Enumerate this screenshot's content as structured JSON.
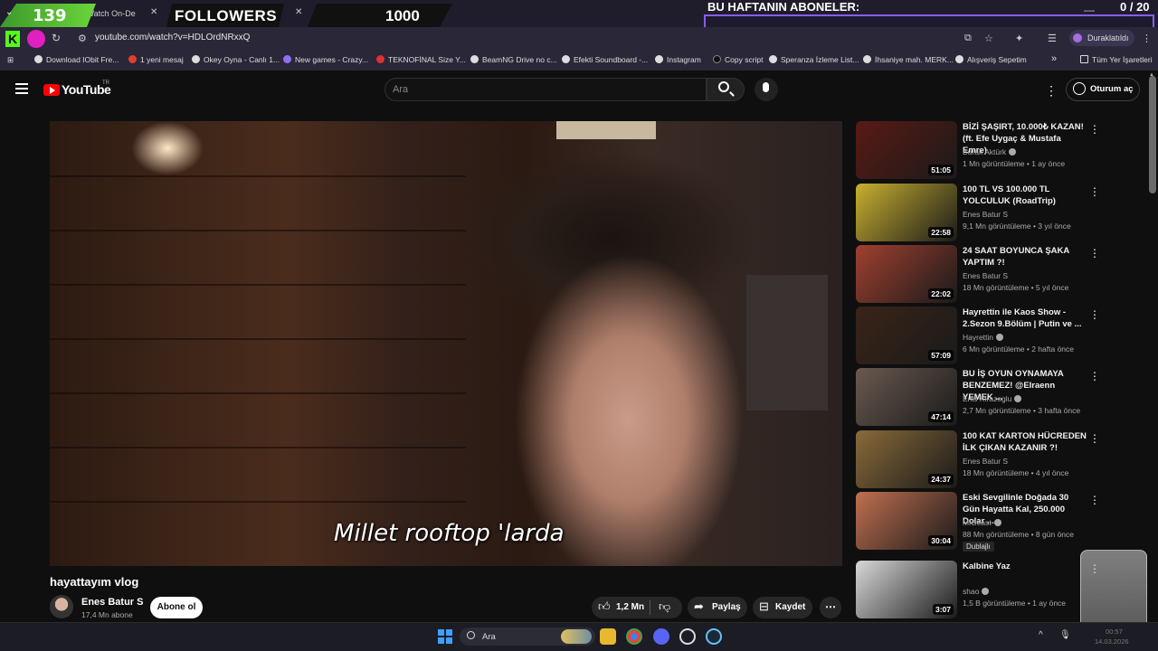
{
  "browser": {
    "tab_title": "deos - Watch On-De",
    "tab_close": "✕",
    "new_tab": "+",
    "url": "youtube.com/watch?v=HDLOrdNRxxQ",
    "profile_label": "Duraklatıldı",
    "window_minimize": "—",
    "bookmarks": [
      "Download IObit Fre...",
      "1 yeni mesaj",
      "Okey Oyna - Canlı 1...",
      "New games - Crazy...",
      "TEKNOFİNAL Size Y...",
      "BeamNG Drive no c...",
      "Efekti Soundboard -...",
      "Instagram",
      "Copy script",
      "Speranza İzleme List...",
      "İhsaniye mah. MERK...",
      "Alışveriş Sepetim",
      "»",
      "Tüm Yer İşaretleri"
    ]
  },
  "overlay": {
    "follower_count": "139",
    "followers_label": "FOLLOWERS",
    "followers_goal": "1000",
    "weekly_subs_title": "BU HAFTANIN ABONELER:",
    "weekly_subs_count": "0 / 20",
    "weekly_subs_progress": 0
  },
  "youtube": {
    "logo_text": "YouTube",
    "country": "TR",
    "search_placeholder": "Ara",
    "signin_label": "Oturum aç",
    "video": {
      "subtitle": "Millet rooftop 'larda",
      "title": "hayattayım vlog",
      "channel": "Enes Batur S",
      "subscribers": "17,4 Mn abone",
      "subscribe_label": "Abone ol",
      "likes": "1,2 Mn",
      "share_label": "Paylaş",
      "save_label": "Kaydet",
      "more_label": "⋯"
    },
    "recommendations": [
      {
        "title": "BİZİ ŞAŞIRT, 10.000₺ KAZAN! (ft. Efe Uygaç & Mustafa Emre)",
        "channel": "Burak Aktürk",
        "verified": true,
        "meta": "1 Mn görüntüleme • 1 ay önce",
        "duration": "51:05",
        "thumb": "#5a1a14"
      },
      {
        "title": "100 TL VS 100.000 TL YOLCULUK (RoadTrip)",
        "channel": "Enes Batur S",
        "verified": false,
        "meta": "9,1 Mn görüntüleme • 3 yıl önce",
        "duration": "22:58",
        "thumb": "#c8b030"
      },
      {
        "title": "24 SAAT BOYUNCA ŞAKA YAPTIM ?!",
        "channel": "Enes Batur S",
        "verified": false,
        "meta": "18 Mn görüntüleme • 5 yıl önce",
        "duration": "22:02",
        "thumb": "#a04030"
      },
      {
        "title": "Hayrettin ile Kaos Show - 2.Sezon 9.Bölüm | Putin ve ...",
        "channel": "Hayrettin",
        "verified": true,
        "meta": "6 Mn görüntüleme • 2 hafta önce",
        "duration": "57:09",
        "thumb": "#3a2418"
      },
      {
        "title": "BU İŞ OYUN OYNAMAYA BENZEMEZ! @Elraenn YEMEK ...",
        "channel": "Enis Kirazoglu",
        "verified": true,
        "meta": "2,7 Mn görüntüleme • 3 hafta önce",
        "duration": "47:14",
        "thumb": "#6a5a50"
      },
      {
        "title": "100 KAT KARTON HÜCREDEN İLK ÇIKAN KAZANIR ?!",
        "channel": "Enes Batur S",
        "verified": false,
        "meta": "18 Mn görüntüleme • 4 yıl önce",
        "duration": "24:37",
        "thumb": "#8a6a3a"
      },
      {
        "title": "Eski Sevgilinle Doğada 30 Gün Hayatta Kal, 250.000 Dolar ...",
        "channel": "MrBeast",
        "verified": true,
        "meta": "88 Mn görüntüleme • 8 gün önce",
        "duration": "30:04",
        "thumb": "#c07050",
        "badge": "Dublajlı"
      },
      {
        "title": "Kalbine Yaz",
        "channel": "shao",
        "verified": true,
        "meta": "1,5 B görüntüleme • 1 ay önce",
        "duration": "3:07",
        "thumb": "#d8d8d8"
      }
    ]
  },
  "taskbar": {
    "search_label": "Ara",
    "time": "00:57",
    "date": "14.03.2026"
  },
  "colors": {
    "youtube_red": "#ff0000",
    "overlay_green": "#53fc18",
    "overlay_purple": "#8b5cf6",
    "background": "#0f0f0f"
  }
}
